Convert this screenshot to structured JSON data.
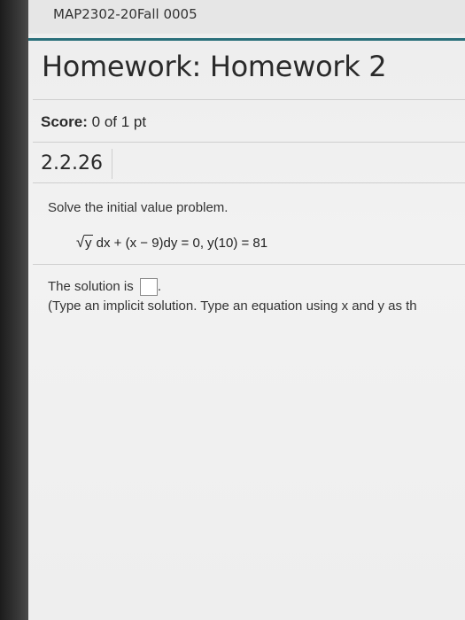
{
  "course": {
    "title": "MAP2302-20Fall 0005"
  },
  "homework": {
    "title": "Homework: Homework 2"
  },
  "score": {
    "label": "Score:",
    "value": "0 of 1 pt"
  },
  "question": {
    "number": "2.2.26",
    "instruction": "Solve the initial value problem.",
    "equation": {
      "radicand": "y",
      "rest": "dx + (x − 9)dy = 0, y(10) = 81"
    },
    "solution_prefix": "The solution is",
    "solution_value": "",
    "solution_suffix": ".",
    "hint": "(Type an implicit solution. Type an equation using x and y as th"
  }
}
